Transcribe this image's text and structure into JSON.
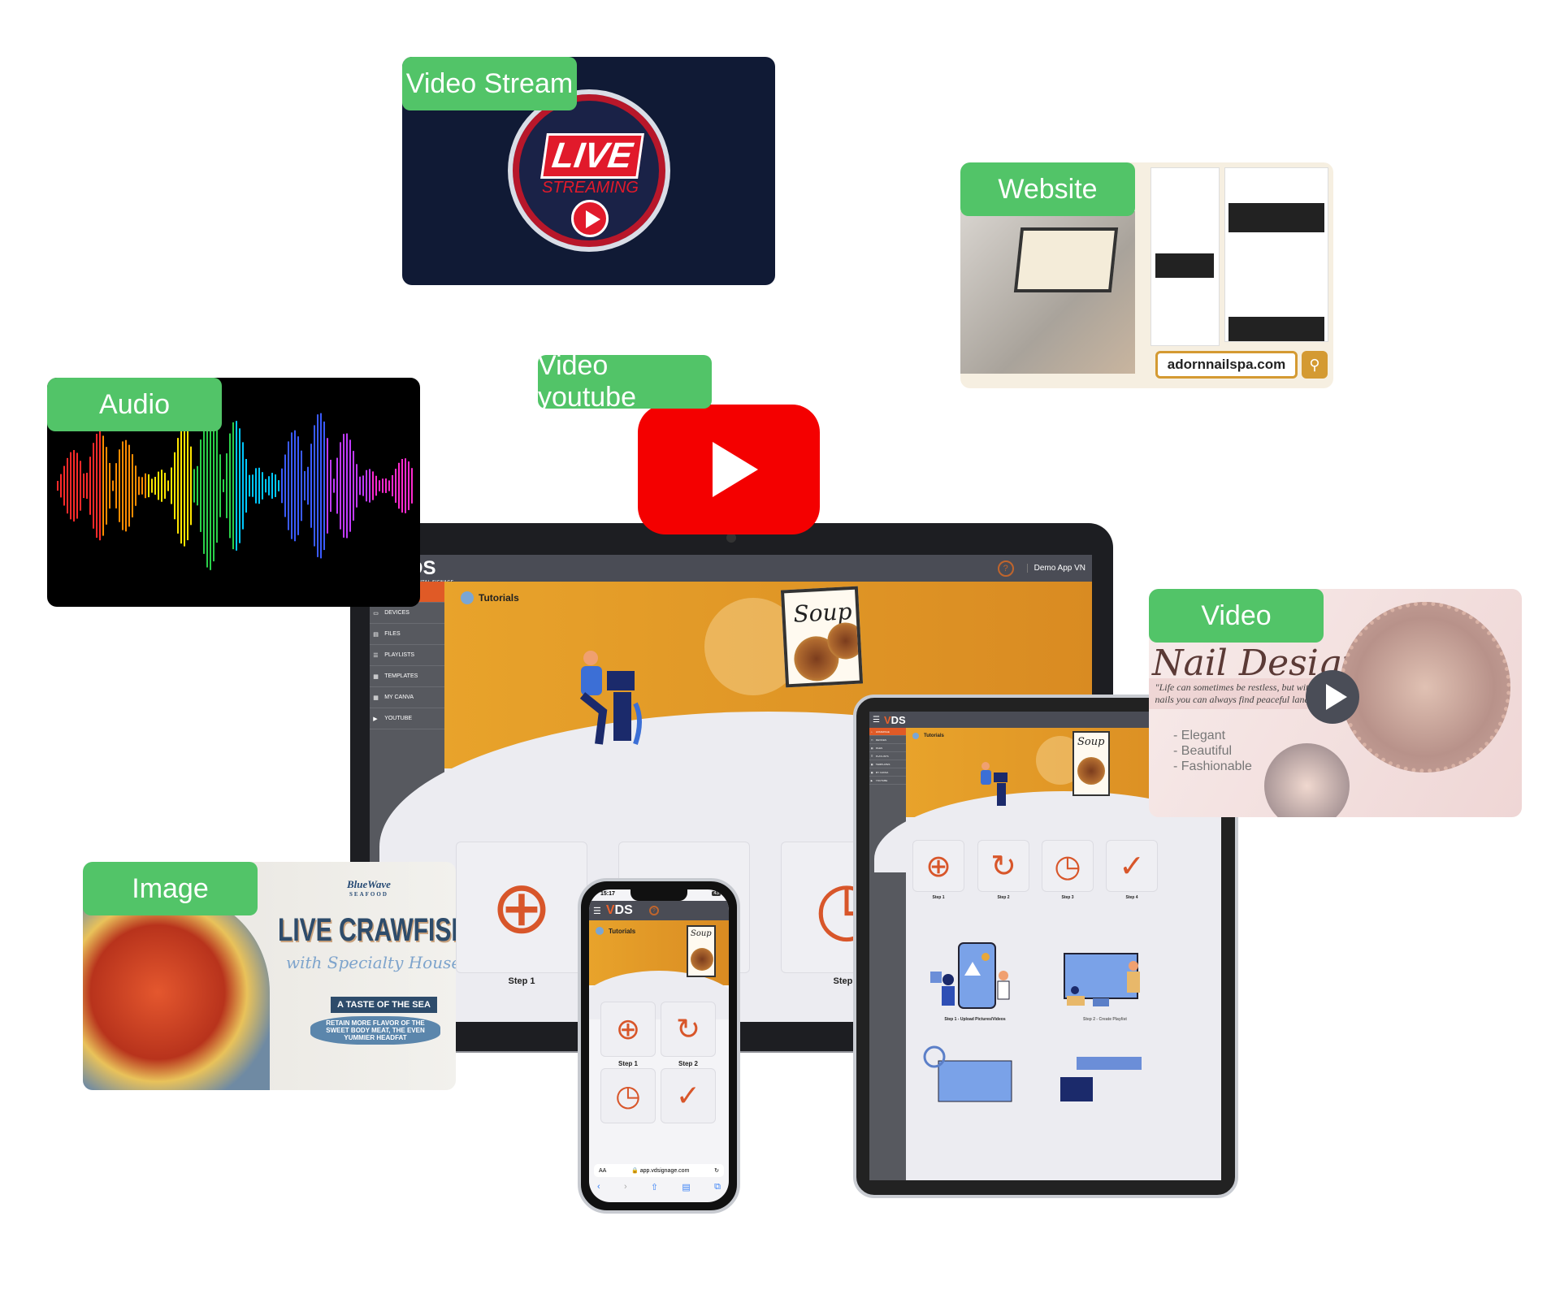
{
  "cards": {
    "video_stream": {
      "label": "Video Stream",
      "live": "LIVE",
      "streaming": "STREAMING"
    },
    "website": {
      "label": "Website",
      "url": "adornnailspa.com",
      "search_icon": "search-icon"
    },
    "audio": {
      "label": "Audio",
      "bar_colors": [
        "#ff2a2a",
        "#ff8c00",
        "#ffe600",
        "#2ad04a",
        "#00c8ff",
        "#3a5bff",
        "#c03aff",
        "#ff2ad0"
      ]
    },
    "youtube": {
      "label": "Video youtube",
      "brand_color": "#f40000"
    },
    "video": {
      "label": "Video",
      "title": "Nail Design",
      "quote": "\"Life can sometimes be restless, but with nails you can always find peaceful land\"",
      "features": [
        "-  Elegant",
        "-  Beautiful",
        "-  Fashionable"
      ]
    },
    "image": {
      "label": "Image",
      "brand": "BlueWave",
      "brand_sub": "SEAFOOD",
      "headline": "LIVE CRAWFISH",
      "subhead": "with Specialty House Sauce",
      "badge": "A TASTE OF THE SEA",
      "body": "RETAIN MORE FLAVOR OF THE SWEET BODY MEAT, THE EVEN YUMMIER HEADFAT"
    }
  },
  "app": {
    "logo": {
      "v": "V",
      "ds": "DS",
      "tagline": "VIDEO DIGITAL SIGNAGE"
    },
    "help": "?",
    "account": "Demo App VN",
    "sidebar": [
      {
        "label": "HOMEPAGE",
        "icon": "home-icon",
        "active": true
      },
      {
        "label": "DEVICES",
        "icon": "monitor-icon"
      },
      {
        "label": "FILES",
        "icon": "file-icon"
      },
      {
        "label": "PLAYLISTS",
        "icon": "list-icon"
      },
      {
        "label": "TEMPLATES",
        "icon": "template-icon"
      },
      {
        "label": "MY CANVA",
        "icon": "canva-icon"
      },
      {
        "label": "YOUTUBE",
        "icon": "youtube-icon"
      }
    ],
    "tutorials": "Tutorials",
    "poster": "Soup",
    "steps": [
      "Step 1",
      "Step 2",
      "Step 3",
      "Step 4"
    ],
    "step_icons": [
      "plus-circle-icon",
      "refresh-icon",
      "clock-icon",
      "check-icon"
    ],
    "guides": [
      "Step 1 - Upload Pictures/Videos",
      "Step 2 - Create Playlist"
    ],
    "accent": "#e05a26"
  },
  "phone": {
    "time": "15:17",
    "battery": "43",
    "url": "app.vdsignage.com",
    "text_size": "AA"
  }
}
